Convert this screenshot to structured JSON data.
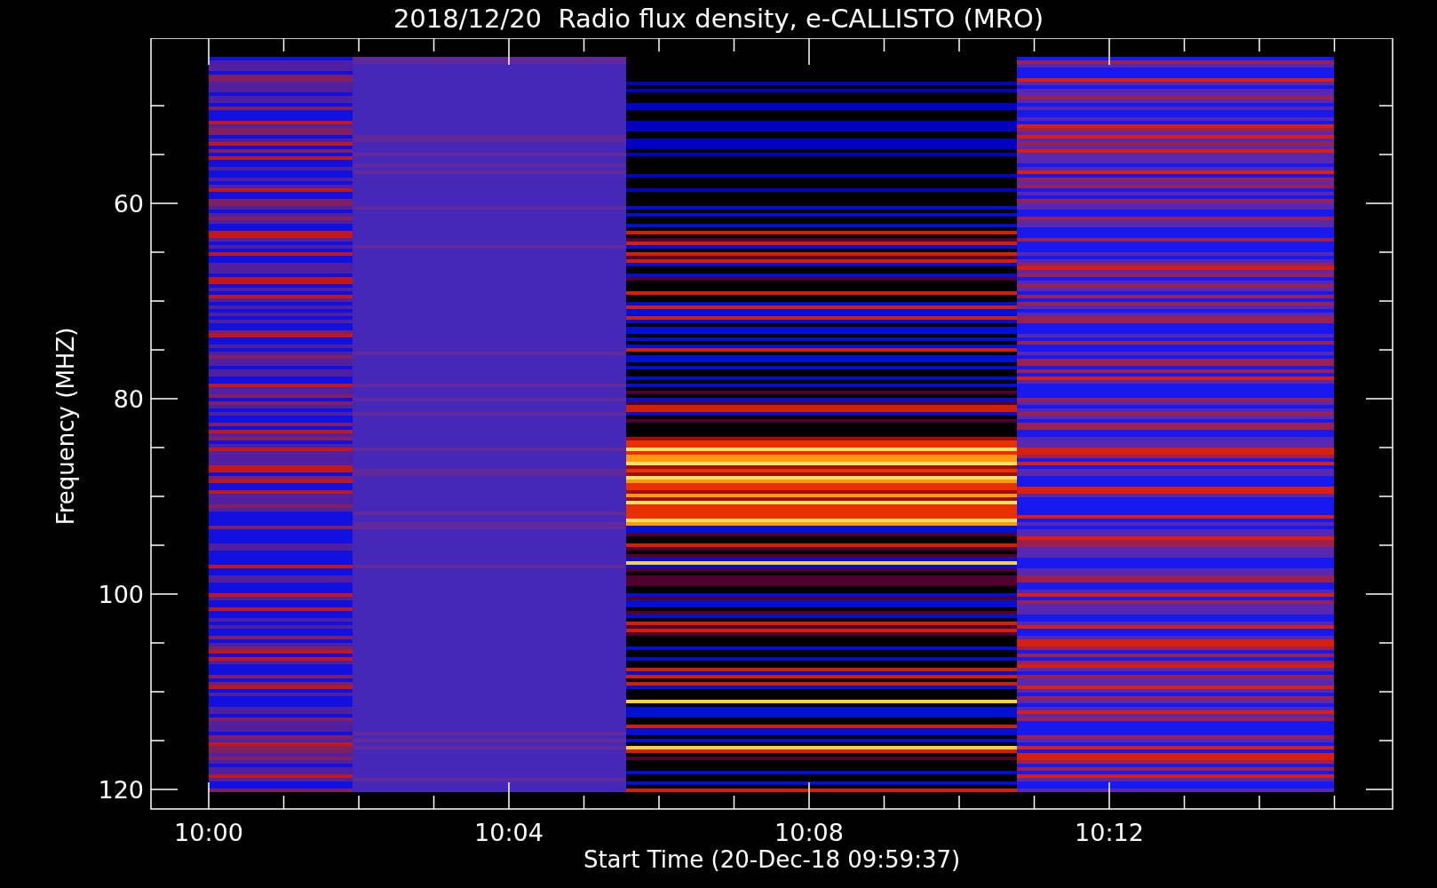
{
  "title": "2018/12/20  Radio flux density, e-CALLISTO (MRO)",
  "y_axis": {
    "label": "Frequency (MHZ)",
    "ticks": [
      "60",
      "80",
      "100",
      "120"
    ]
  },
  "x_axis": {
    "label": "Start Time (20-Dec-18 09:59:37)",
    "ticks": [
      "10:00",
      "10:04",
      "10:08",
      "10:12"
    ]
  }
}
